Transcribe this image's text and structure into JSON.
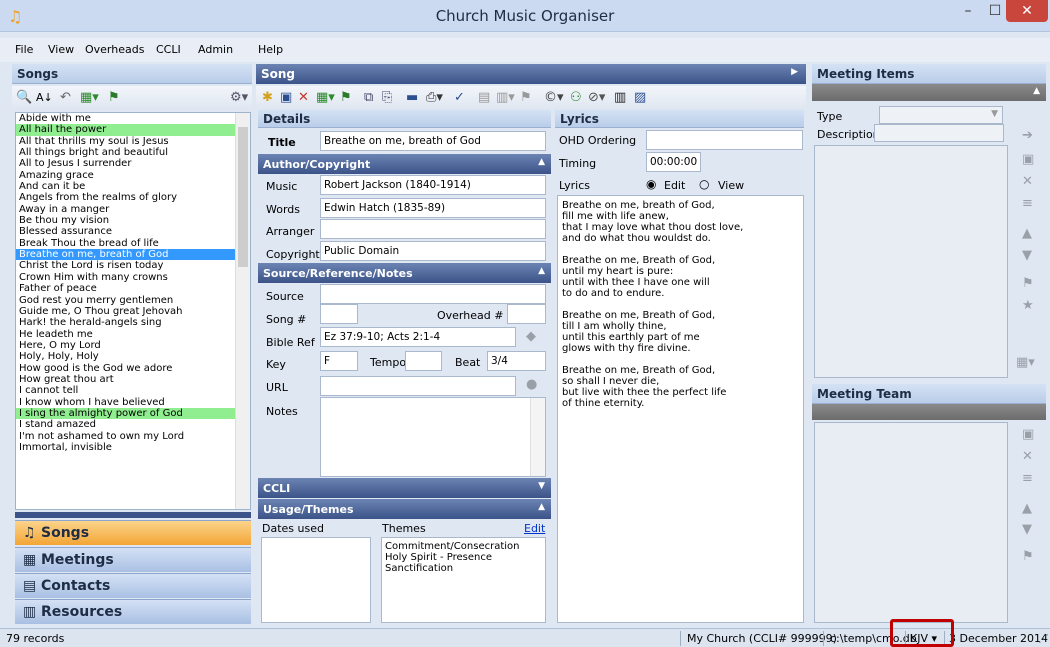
{
  "window": {
    "title": "Church Music Organiser",
    "min": "–",
    "max": "☐",
    "close": "✕"
  },
  "menu": [
    "File",
    "View",
    "Overheads",
    "CCLI",
    "Admin",
    "Help"
  ],
  "songs_panel": {
    "header": "Songs",
    "items": [
      {
        "t": "Abide with me",
        "s": ""
      },
      {
        "t": "All hail the power",
        "s": "green"
      },
      {
        "t": "All that thrills my soul is Jesus",
        "s": ""
      },
      {
        "t": "All things bright and beautiful",
        "s": ""
      },
      {
        "t": "All to Jesus I surrender",
        "s": ""
      },
      {
        "t": "Amazing grace",
        "s": ""
      },
      {
        "t": "And can it be",
        "s": ""
      },
      {
        "t": "Angels from the realms of glory",
        "s": ""
      },
      {
        "t": "Away in a manger",
        "s": ""
      },
      {
        "t": "Be thou my vision",
        "s": ""
      },
      {
        "t": "Blessed assurance",
        "s": ""
      },
      {
        "t": "Break Thou the bread of life",
        "s": ""
      },
      {
        "t": "Breathe on me, breath of God",
        "s": "selected"
      },
      {
        "t": "Christ the Lord is risen today",
        "s": ""
      },
      {
        "t": "Crown Him with many crowns",
        "s": ""
      },
      {
        "t": "Father of peace",
        "s": ""
      },
      {
        "t": "God rest you merry gentlemen",
        "s": ""
      },
      {
        "t": "Guide me, O Thou great Jehovah",
        "s": ""
      },
      {
        "t": "Hark! the herald-angels sing",
        "s": ""
      },
      {
        "t": "He leadeth me",
        "s": ""
      },
      {
        "t": "Here, O my Lord",
        "s": ""
      },
      {
        "t": "Holy, Holy, Holy",
        "s": ""
      },
      {
        "t": "How good is the God we adore",
        "s": ""
      },
      {
        "t": "How great thou art",
        "s": ""
      },
      {
        "t": "I cannot tell",
        "s": ""
      },
      {
        "t": "I know whom I have believed",
        "s": ""
      },
      {
        "t": "I sing the almighty power of God",
        "s": "green"
      },
      {
        "t": "I stand amazed",
        "s": ""
      },
      {
        "t": "I'm not ashamed to own my Lord",
        "s": ""
      },
      {
        "t": "Immortal, invisible",
        "s": ""
      }
    ]
  },
  "nav": {
    "songs": "Songs",
    "meetings": "Meetings",
    "contacts": "Contacts",
    "resources": "Resources"
  },
  "song_panel": {
    "header": "Song",
    "details": "Details",
    "title_label": "Title",
    "title_value": "Breathe on me, breath of God",
    "author_hdr": "Author/Copyright",
    "music_label": "Music",
    "music_value": "Robert Jackson (1840-1914)",
    "words_label": "Words",
    "words_value": "Edwin Hatch (1835-89)",
    "arranger_label": "Arranger",
    "arranger_value": "",
    "copyright_label": "Copyright",
    "copyright_value": "Public Domain",
    "source_hdr": "Source/Reference/Notes",
    "source_label": "Source",
    "source_value": "",
    "songnum_label": "Song #",
    "overhead_label": "Overhead #",
    "bibleref_label": "Bible Ref",
    "bibleref_value": "Ez 37:9-10; Acts 2:1-4",
    "key_label": "Key",
    "key_value": "F",
    "tempo_label": "Tempo",
    "tempo_value": "",
    "beat_label": "Beat",
    "beat_value": "3/4",
    "url_label": "URL",
    "url_value": "",
    "notes_label": "Notes",
    "ccli_hdr": "CCLI",
    "usage_hdr": "Usage/Themes",
    "dates_used_label": "Dates used",
    "themes_label": "Themes",
    "edit_link": "Edit",
    "themes": [
      "Commitment/Consecration",
      "Holy Spirit - Presence",
      "Sanctification"
    ]
  },
  "lyrics_panel": {
    "header": "Lyrics",
    "ohd_label": "OHD Ordering",
    "ohd_value": "",
    "timing_label": "Timing",
    "timing_value": "00:00:00",
    "lyrics_label": "Lyrics",
    "edit_opt": "Edit",
    "view_opt": "View",
    "stanzas": [
      [
        "Breathe on me, breath of God,",
        "fill me with life anew,",
        "that I may love what thou dost love,",
        "and do what thou wouldst do."
      ],
      [
        "Breathe on me, Breath of God,",
        "until my heart is pure:",
        "until with thee I have one will",
        "to do and to endure."
      ],
      [
        "Breathe on me, Breath of God,",
        "till I am wholly thine,",
        "until this earthly part of me",
        "glows with thy fire divine."
      ],
      [
        "Breathe on me, Breath of God,",
        "so shall I never die,",
        "but live with thee the perfect life",
        "of thine eternity."
      ]
    ]
  },
  "meeting_items": {
    "header": "Meeting Items",
    "type_label": "Type",
    "desc_label": "Description"
  },
  "meeting_team": {
    "header": "Meeting Team"
  },
  "status": {
    "records": "79 records",
    "church": "My Church (CCLI# 999999)",
    "db": "c:\\temp\\cmo.db",
    "version": "KJV",
    "date": "3 December 2014"
  },
  "colors": {
    "selected": "#3399ff",
    "highlight": "#90ee90",
    "active_nav": "#f3a536",
    "highlight_box": "#c00000"
  }
}
